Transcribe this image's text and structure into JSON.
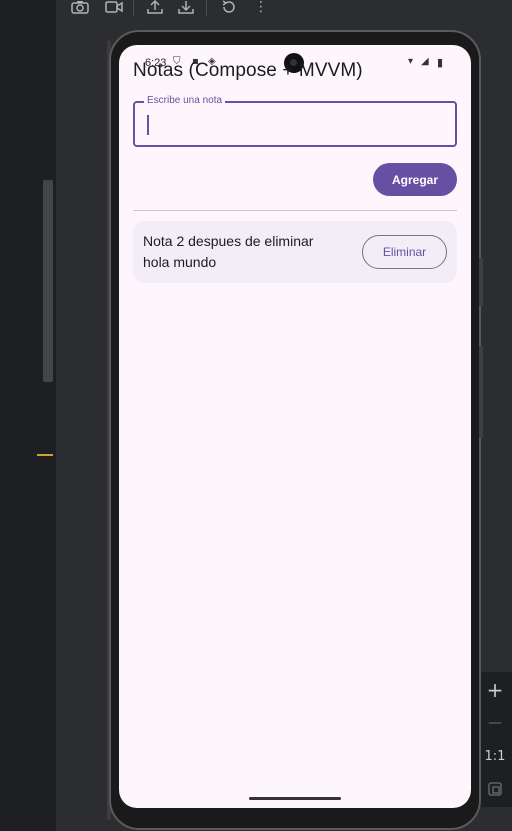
{
  "ide": {
    "toolbar_icons": [
      "camera-icon",
      "video-icon",
      "upload-icon",
      "download-icon",
      "rotate-icon",
      "more-vert-icon"
    ],
    "zoom_label": "1:1",
    "zoom_in_glyph": "+",
    "zoom_out_glyph": "—"
  },
  "device": {
    "status_time": "6:23",
    "status_icons": [
      "shield-icon",
      "sim-icon",
      "vpn-icon",
      "wifi-icon",
      "signal-icon",
      "battery-icon"
    ]
  },
  "app": {
    "title": "Notas (Compose + MVVM)",
    "input": {
      "label": "Escribe una nota",
      "value": "",
      "placeholder": ""
    },
    "add_button": "Agregar",
    "notes": [
      {
        "text": "Nota 2 despues de eliminar hola mundo",
        "delete_label": "Eliminar"
      }
    ]
  },
  "colors": {
    "primary": "#6750a4",
    "surface": "#fdf6fc",
    "card": "#f3edf7",
    "ide_bg": "#2b2d30"
  }
}
